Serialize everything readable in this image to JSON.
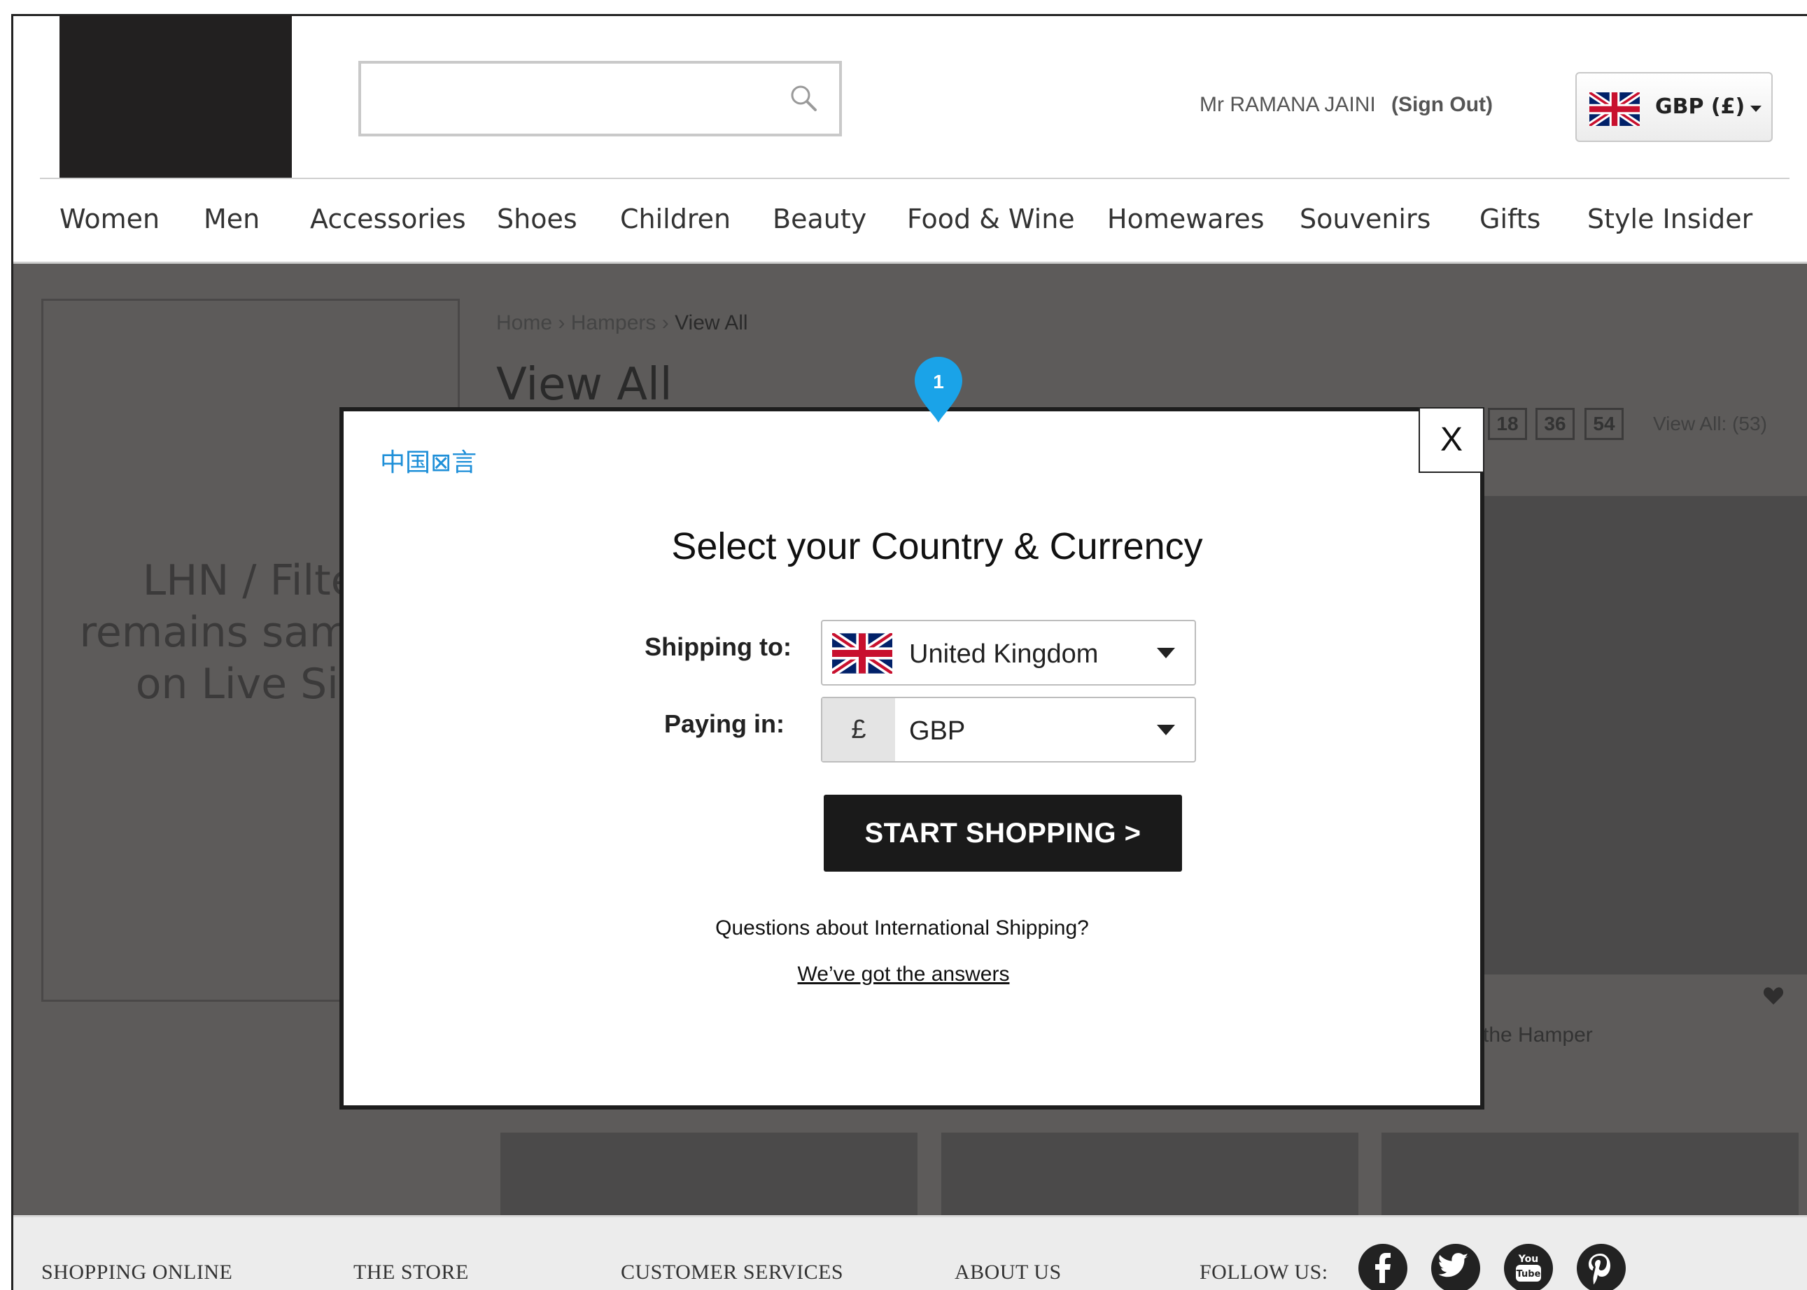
{
  "header": {
    "search_placeholder": "",
    "user_name": "Mr RAMANA JAINI",
    "sign_out": "(Sign Out)",
    "currency_label": "GBP (£)"
  },
  "nav": {
    "items": [
      "Women",
      "Men",
      "Accessories",
      "Shoes",
      "Children",
      "Beauty",
      "Food & Wine",
      "Homewares",
      "Souvenirs",
      "Gifts",
      "Style Insider"
    ]
  },
  "page": {
    "breadcrumb": {
      "home": "Home",
      "sep1": " › ",
      "section": "Hampers",
      "sep2": " › ",
      "current": "View All"
    },
    "title": "View All",
    "lhn_placeholder": "LHN / Filter remains same as on Live Site",
    "per_page_options": [
      "18",
      "36",
      "54"
    ],
    "view_all_count": "View All: (53)",
    "product_name_fragment": "the Hamper"
  },
  "modal": {
    "marker_number": "1",
    "language_link": "中国⊠言",
    "close_label": "X",
    "title": "Select your Country & Currency",
    "shipping_label": "Shipping to:",
    "shipping_value": "United Kingdom",
    "paying_label": "Paying in:",
    "currency_symbol": "£",
    "paying_value": "GBP",
    "start_button": "START SHOPPING >",
    "faq_question": "Questions about International Shipping?",
    "faq_link": "We’ve got the answers"
  },
  "footer": {
    "links": [
      "SHOPPING ONLINE",
      "THE STORE",
      "CUSTOMER SERVICES",
      "ABOUT US"
    ],
    "follow_label": "FOLLOW US:",
    "social_icons": [
      "facebook-icon",
      "twitter-icon",
      "youtube-icon",
      "pinterest-icon"
    ]
  },
  "colors": {
    "overlay_bg": "#5d5b5a",
    "link_blue": "#1e8fd8",
    "marker_blue": "#1aa3e8",
    "button_black": "#1a1a1a"
  }
}
